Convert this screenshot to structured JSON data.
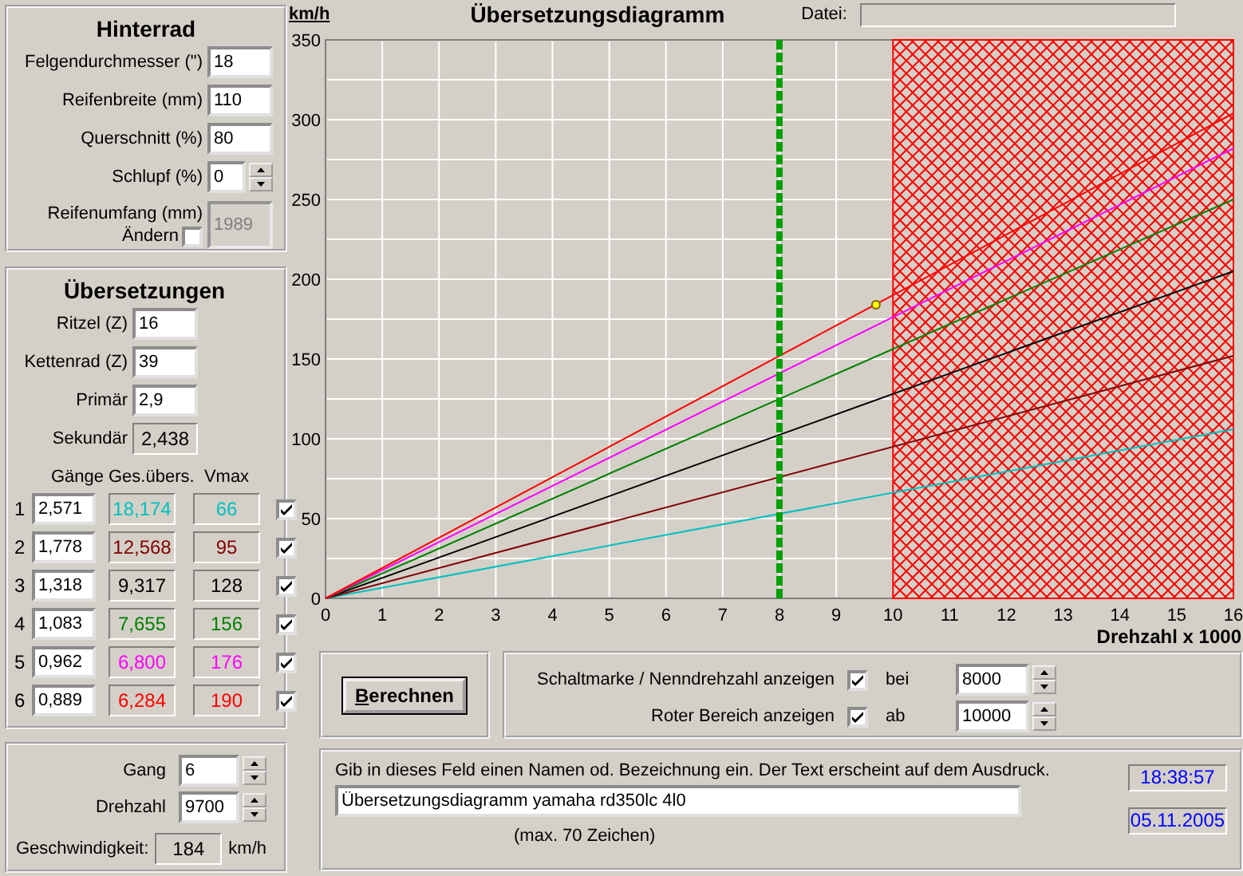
{
  "hinterrad": {
    "title": "Hinterrad",
    "fields": [
      {
        "label": "Felgendurchmesser (\")",
        "value": "18",
        "kind": "input"
      },
      {
        "label": "Reifenbreite (mm)",
        "value": "110",
        "kind": "input"
      },
      {
        "label": "Querschnitt (%)",
        "value": "80",
        "kind": "input"
      },
      {
        "label": "Schlupf (%)",
        "value": "0",
        "kind": "spin"
      }
    ],
    "umfang": {
      "label": "Reifenumfang (mm)",
      "change_label": "Ändern",
      "checked": false,
      "value": "1989",
      "disabled": true
    }
  },
  "uebersetzungen": {
    "title": "Übersetzungen",
    "fields": [
      {
        "label": "Ritzel (Z)",
        "value": "16",
        "kind": "input"
      },
      {
        "label": "Kettenrad (Z)",
        "value": "39",
        "kind": "input"
      },
      {
        "label": "Primär",
        "value": "2,9",
        "kind": "input"
      },
      {
        "label": "Sekundär",
        "value": "2,438",
        "kind": "readout"
      }
    ],
    "columns": [
      "Gänge",
      "Ges.übers.",
      "Vmax"
    ],
    "gears": [
      {
        "number": "1",
        "ratio": "2,571",
        "total": "18,174",
        "vmax": "66",
        "color": "#00c0c0",
        "checked": true
      },
      {
        "number": "2",
        "ratio": "1,778",
        "total": "12,568",
        "vmax": "95",
        "color": "#800000",
        "checked": true
      },
      {
        "number": "3",
        "ratio": "1,318",
        "total": "9,317",
        "vmax": "128",
        "color": "#000000",
        "checked": true
      },
      {
        "number": "4",
        "ratio": "1,083",
        "total": "7,655",
        "vmax": "156",
        "color": "#008000",
        "checked": true
      },
      {
        "number": "5",
        "ratio": "0,962",
        "total": "6,800",
        "vmax": "176",
        "color": "#ff00ff",
        "checked": true
      },
      {
        "number": "6",
        "ratio": "0,889",
        "total": "6,284",
        "vmax": "190",
        "color": "#ff0000",
        "checked": true
      }
    ]
  },
  "status": {
    "fields": [
      {
        "label": "Gang",
        "value": "6"
      },
      {
        "label": "Drehzahl",
        "value": "9700"
      }
    ],
    "speed": {
      "label": "Geschwindigkeit:",
      "value": "184",
      "unit": "km/h"
    }
  },
  "diagram": {
    "file_label": "Datei:",
    "chart_data": {
      "type": "line",
      "title": "Übersetzungsdiagramm",
      "xlabel": "Drehzahl x 1000",
      "ylabel": "km/h",
      "x": [
        0,
        16
      ],
      "series": [
        {
          "color": "#00c0c0",
          "values": [
            0,
            106
          ]
        },
        {
          "color": "#800000",
          "values": [
            0,
            152
          ]
        },
        {
          "color": "#000000",
          "values": [
            0,
            205
          ]
        },
        {
          "color": "#008000",
          "values": [
            0,
            250
          ]
        },
        {
          "color": "#ff00ff",
          "values": [
            0,
            282
          ]
        },
        {
          "color": "#ff0000",
          "values": [
            0,
            304
          ]
        }
      ],
      "grid": true,
      "ref_lines": [
        {
          "axis": "x",
          "value": 8,
          "color": "#00a000"
        }
      ],
      "bands": [
        {
          "axis": "x",
          "from": 10,
          "to": 16,
          "color": "#ff0000"
        }
      ],
      "xlim": [
        0,
        16
      ],
      "ylim": [
        0,
        350
      ],
      "xticks": [
        0,
        1,
        2,
        3,
        4,
        5,
        6,
        7,
        8,
        9,
        10,
        11,
        12,
        13,
        14,
        15,
        16
      ],
      "yticks": [
        0,
        50,
        100,
        150,
        200,
        250,
        300,
        350
      ]
    }
  },
  "calculate_button": "Berechnen",
  "settings": [
    {
      "label": "Schaltmarke / Nenndrehzahl anzeigen",
      "checked": true,
      "prep": "bei",
      "value": "8000"
    },
    {
      "label": "Roter Bereich anzeigen",
      "checked": true,
      "prep": "ab",
      "value": "10000"
    }
  ],
  "note": {
    "hint": "Gib in dieses Feld einen Namen od. Bezeichnung ein. Der Text erscheint auf dem Ausdruck.",
    "value": "Übersetzungsdiagramm yamaha rd350lc 4l0",
    "limit": "(max. 70 Zeichen)",
    "time": "18:38:57",
    "date": "05.11.2005"
  }
}
